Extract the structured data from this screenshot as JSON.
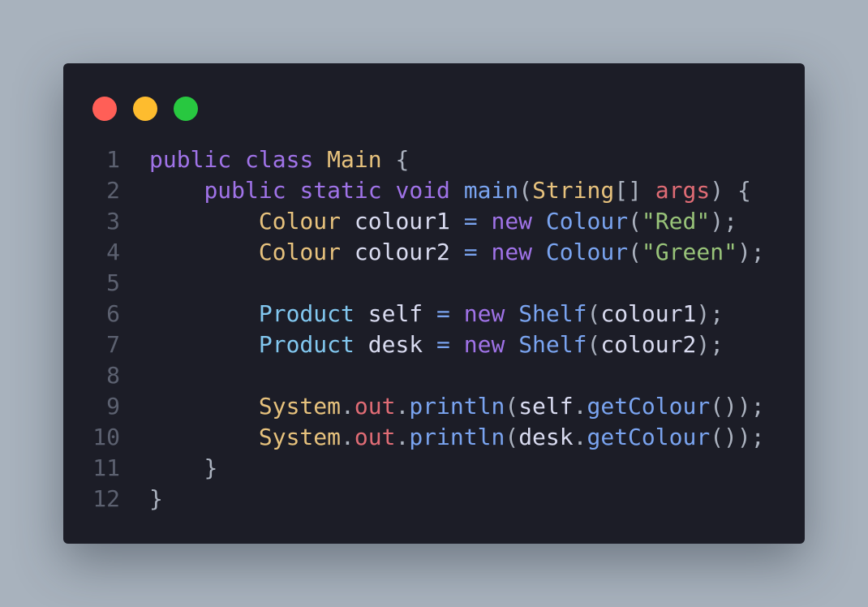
{
  "window": {
    "buttons": [
      {
        "name": "close",
        "color": "#ff5f57"
      },
      {
        "name": "minimize",
        "color": "#febc2e"
      },
      {
        "name": "maximize",
        "color": "#28c840"
      }
    ]
  },
  "colors": {
    "background": "#a8b2bd",
    "editor": "#1c1d27",
    "line_number": "#5c6170",
    "keyword": "#a073e8",
    "type": "#e7c27d",
    "class_ref": "#82c8f0",
    "constructor": "#7aa4f0",
    "variable": "#d9dbf0",
    "field": "#e06c75",
    "string": "#98c379",
    "punctuation": "#abb2bf"
  },
  "code": {
    "lines": [
      {
        "n": "1",
        "tokens": [
          {
            "t": "public",
            "c": "keyword"
          },
          {
            "t": " ",
            "c": "plain"
          },
          {
            "t": "class",
            "c": "keyword"
          },
          {
            "t": " ",
            "c": "plain"
          },
          {
            "t": "Main",
            "c": "type"
          },
          {
            "t": " {",
            "c": "punctuation"
          }
        ]
      },
      {
        "n": "2",
        "tokens": [
          {
            "t": "    ",
            "c": "plain"
          },
          {
            "t": "public",
            "c": "keyword"
          },
          {
            "t": " ",
            "c": "plain"
          },
          {
            "t": "static",
            "c": "keyword"
          },
          {
            "t": " ",
            "c": "plain"
          },
          {
            "t": "void",
            "c": "keyword"
          },
          {
            "t": " ",
            "c": "plain"
          },
          {
            "t": "main",
            "c": "constructor"
          },
          {
            "t": "(",
            "c": "punctuation"
          },
          {
            "t": "String",
            "c": "type"
          },
          {
            "t": "[] ",
            "c": "punctuation"
          },
          {
            "t": "args",
            "c": "field"
          },
          {
            "t": ") {",
            "c": "punctuation"
          }
        ]
      },
      {
        "n": "3",
        "tokens": [
          {
            "t": "        ",
            "c": "plain"
          },
          {
            "t": "Colour",
            "c": "type"
          },
          {
            "t": " ",
            "c": "plain"
          },
          {
            "t": "colour1",
            "c": "variable"
          },
          {
            "t": " ",
            "c": "plain"
          },
          {
            "t": "=",
            "c": "constructor"
          },
          {
            "t": " ",
            "c": "plain"
          },
          {
            "t": "new",
            "c": "keyword"
          },
          {
            "t": " ",
            "c": "plain"
          },
          {
            "t": "Colour",
            "c": "constructor"
          },
          {
            "t": "(",
            "c": "punctuation"
          },
          {
            "t": "\"Red\"",
            "c": "string"
          },
          {
            "t": ");",
            "c": "punctuation"
          }
        ]
      },
      {
        "n": "4",
        "tokens": [
          {
            "t": "        ",
            "c": "plain"
          },
          {
            "t": "Colour",
            "c": "type"
          },
          {
            "t": " ",
            "c": "plain"
          },
          {
            "t": "colour2",
            "c": "variable"
          },
          {
            "t": " ",
            "c": "plain"
          },
          {
            "t": "=",
            "c": "constructor"
          },
          {
            "t": " ",
            "c": "plain"
          },
          {
            "t": "new",
            "c": "keyword"
          },
          {
            "t": " ",
            "c": "plain"
          },
          {
            "t": "Colour",
            "c": "constructor"
          },
          {
            "t": "(",
            "c": "punctuation"
          },
          {
            "t": "\"Green\"",
            "c": "string"
          },
          {
            "t": ");",
            "c": "punctuation"
          }
        ]
      },
      {
        "n": "5",
        "tokens": []
      },
      {
        "n": "6",
        "tokens": [
          {
            "t": "        ",
            "c": "plain"
          },
          {
            "t": "Product",
            "c": "class_ref"
          },
          {
            "t": " ",
            "c": "plain"
          },
          {
            "t": "self",
            "c": "variable"
          },
          {
            "t": " ",
            "c": "plain"
          },
          {
            "t": "=",
            "c": "constructor"
          },
          {
            "t": " ",
            "c": "plain"
          },
          {
            "t": "new",
            "c": "keyword"
          },
          {
            "t": " ",
            "c": "plain"
          },
          {
            "t": "Shelf",
            "c": "constructor"
          },
          {
            "t": "(",
            "c": "punctuation"
          },
          {
            "t": "colour1",
            "c": "variable"
          },
          {
            "t": ");",
            "c": "punctuation"
          }
        ]
      },
      {
        "n": "7",
        "tokens": [
          {
            "t": "        ",
            "c": "plain"
          },
          {
            "t": "Product",
            "c": "class_ref"
          },
          {
            "t": " ",
            "c": "plain"
          },
          {
            "t": "desk",
            "c": "variable"
          },
          {
            "t": " ",
            "c": "plain"
          },
          {
            "t": "=",
            "c": "constructor"
          },
          {
            "t": " ",
            "c": "plain"
          },
          {
            "t": "new",
            "c": "keyword"
          },
          {
            "t": " ",
            "c": "plain"
          },
          {
            "t": "Shelf",
            "c": "constructor"
          },
          {
            "t": "(",
            "c": "punctuation"
          },
          {
            "t": "colour2",
            "c": "variable"
          },
          {
            "t": ");",
            "c": "punctuation"
          }
        ]
      },
      {
        "n": "8",
        "tokens": []
      },
      {
        "n": "9",
        "tokens": [
          {
            "t": "        ",
            "c": "plain"
          },
          {
            "t": "System",
            "c": "type"
          },
          {
            "t": ".",
            "c": "punctuation"
          },
          {
            "t": "out",
            "c": "field"
          },
          {
            "t": ".",
            "c": "punctuation"
          },
          {
            "t": "println",
            "c": "constructor"
          },
          {
            "t": "(",
            "c": "punctuation"
          },
          {
            "t": "self",
            "c": "variable"
          },
          {
            "t": ".",
            "c": "punctuation"
          },
          {
            "t": "getColour",
            "c": "constructor"
          },
          {
            "t": "());",
            "c": "punctuation"
          }
        ]
      },
      {
        "n": "10",
        "tokens": [
          {
            "t": "        ",
            "c": "plain"
          },
          {
            "t": "System",
            "c": "type"
          },
          {
            "t": ".",
            "c": "punctuation"
          },
          {
            "t": "out",
            "c": "field"
          },
          {
            "t": ".",
            "c": "punctuation"
          },
          {
            "t": "println",
            "c": "constructor"
          },
          {
            "t": "(",
            "c": "punctuation"
          },
          {
            "t": "desk",
            "c": "variable"
          },
          {
            "t": ".",
            "c": "punctuation"
          },
          {
            "t": "getColour",
            "c": "constructor"
          },
          {
            "t": "());",
            "c": "punctuation"
          }
        ]
      },
      {
        "n": "11",
        "tokens": [
          {
            "t": "    ",
            "c": "plain"
          },
          {
            "t": "}",
            "c": "punctuation"
          }
        ]
      },
      {
        "n": "12",
        "tokens": [
          {
            "t": "}",
            "c": "punctuation"
          }
        ]
      }
    ]
  }
}
